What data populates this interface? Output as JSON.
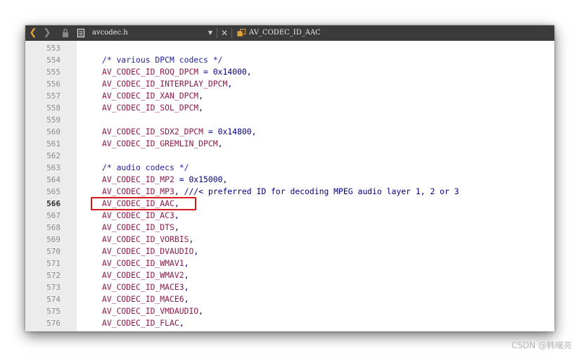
{
  "tabbar": {
    "back_glyph": "❮",
    "forward_glyph": "❯",
    "file_name": "avcodec.h",
    "dropdown_glyph": "▼",
    "close_glyph": "✕",
    "symbol_name": "AV_CODEC_ID_AAC"
  },
  "editor": {
    "current_line": "566",
    "lines": [
      {
        "num": "553",
        "ident": "",
        "rest": "",
        "comment": ""
      },
      {
        "num": "554",
        "ident": "",
        "rest": "",
        "comment": "/* various DPCM codecs */"
      },
      {
        "num": "555",
        "ident": "AV_CODEC_ID_ROQ_DPCM",
        "rest": " = 0x14000,",
        "comment": ""
      },
      {
        "num": "556",
        "ident": "AV_CODEC_ID_INTERPLAY_DPCM",
        "rest": ",",
        "comment": ""
      },
      {
        "num": "557",
        "ident": "AV_CODEC_ID_XAN_DPCM",
        "rest": ",",
        "comment": ""
      },
      {
        "num": "558",
        "ident": "AV_CODEC_ID_SOL_DPCM",
        "rest": ",",
        "comment": ""
      },
      {
        "num": "559",
        "ident": "",
        "rest": "",
        "comment": ""
      },
      {
        "num": "560",
        "ident": "AV_CODEC_ID_SDX2_DPCM",
        "rest": " = 0x14800,",
        "comment": ""
      },
      {
        "num": "561",
        "ident": "AV_CODEC_ID_GREMLIN_DPCM",
        "rest": ",",
        "comment": ""
      },
      {
        "num": "562",
        "ident": "",
        "rest": "",
        "comment": ""
      },
      {
        "num": "563",
        "ident": "",
        "rest": "",
        "comment": "/* audio codecs */"
      },
      {
        "num": "564",
        "ident": "AV_CODEC_ID_MP2",
        "rest": " = 0x15000,",
        "comment": ""
      },
      {
        "num": "565",
        "ident": "AV_CODEC_ID_MP3",
        "rest": ", ///< preferred ID for decoding MPEG audio layer 1, 2 or 3",
        "comment": ""
      },
      {
        "num": "566",
        "ident": "AV_CODEC_ID_AAC",
        "rest": ",",
        "comment": ""
      },
      {
        "num": "567",
        "ident": "AV_CODEC_ID_AC3",
        "rest": ",",
        "comment": ""
      },
      {
        "num": "568",
        "ident": "AV_CODEC_ID_DTS",
        "rest": ",",
        "comment": ""
      },
      {
        "num": "569",
        "ident": "AV_CODEC_ID_VORBIS",
        "rest": ",",
        "comment": ""
      },
      {
        "num": "570",
        "ident": "AV_CODEC_ID_DVAUDIO",
        "rest": ",",
        "comment": ""
      },
      {
        "num": "571",
        "ident": "AV_CODEC_ID_WMAV1",
        "rest": ",",
        "comment": ""
      },
      {
        "num": "572",
        "ident": "AV_CODEC_ID_WMAV2",
        "rest": ",",
        "comment": ""
      },
      {
        "num": "573",
        "ident": "AV_CODEC_ID_MACE3",
        "rest": ",",
        "comment": ""
      },
      {
        "num": "574",
        "ident": "AV_CODEC_ID_MACE6",
        "rest": ",",
        "comment": ""
      },
      {
        "num": "575",
        "ident": "AV_CODEC_ID_VMDAUDIO",
        "rest": ",",
        "comment": ""
      },
      {
        "num": "576",
        "ident": "AV_CODEC_ID_FLAC",
        "rest": ",",
        "comment": ""
      }
    ]
  },
  "colors": {
    "identifier": "#8b1a4a",
    "comment": "#1f1f9e",
    "highlight_border": "#d41a1a",
    "tabbar_bg": "#3b3b3b"
  },
  "watermark": "CSDN @韩曙亮"
}
